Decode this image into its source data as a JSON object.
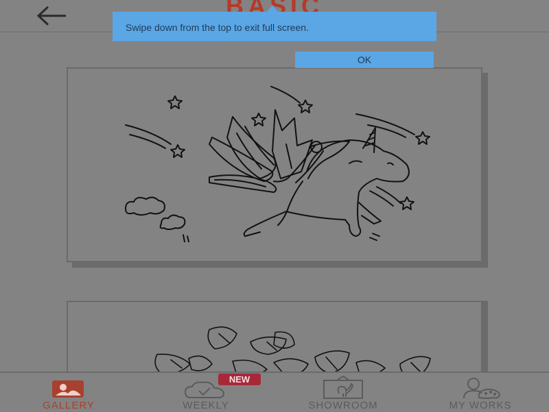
{
  "header": {
    "title": "BASIC",
    "back_icon": "arrow-left-icon"
  },
  "toast": {
    "message": "Swipe down from the top to exit full screen.",
    "ok_label": "OK"
  },
  "gallery": {
    "cards": [
      {
        "subject": "unicorn-with-wings"
      },
      {
        "subject": "flowers-and-leaves"
      }
    ]
  },
  "bottom_nav": {
    "items": [
      {
        "label": "GALLERY",
        "icon": "gallery-icon",
        "active": true
      },
      {
        "label": "WEEKLY",
        "icon": "cloud-check-icon",
        "badge": "NEW"
      },
      {
        "label": "SHOWROOM",
        "icon": "flamingo-frame-icon"
      },
      {
        "label": "MY WORKS",
        "icon": "user-palette-icon"
      }
    ]
  },
  "colors": {
    "accent": "#a8402f",
    "toast": "#5ba6e4",
    "badge": "#a8283a"
  }
}
